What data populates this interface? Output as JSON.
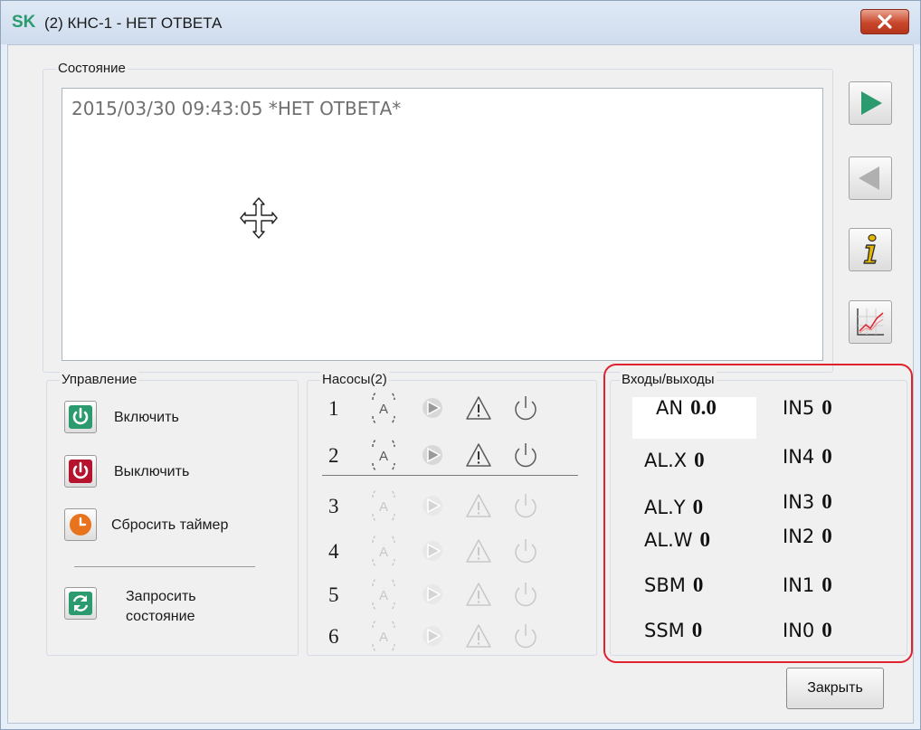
{
  "window": {
    "app_mark": "SK",
    "title": "(2) КНС-1 - НЕТ ОТВЕТА"
  },
  "status": {
    "legend": "Состояние",
    "line": "2015/03/30 09:43:05 *НЕТ ОТВЕТА*"
  },
  "side_buttons": [
    {
      "icon": "play-forward-icon"
    },
    {
      "icon": "play-back-icon"
    },
    {
      "icon": "info-icon"
    },
    {
      "icon": "chart-icon"
    }
  ],
  "control": {
    "legend": "Управление",
    "buttons": [
      {
        "label": "Включить",
        "icon": "power-on-icon"
      },
      {
        "label": "Выключить",
        "icon": "power-off-icon"
      },
      {
        "label": "Сбросить таймер",
        "icon": "timer-icon"
      },
      {
        "label_line1": "Запросить",
        "label_line2": "состояние",
        "icon": "refresh-icon"
      }
    ]
  },
  "pumps": {
    "legend": "Насосы(2)",
    "rows": [
      {
        "num": "1",
        "active": true
      },
      {
        "num": "2",
        "active": true
      },
      {
        "num": "3",
        "active": false
      },
      {
        "num": "4",
        "active": false
      },
      {
        "num": "5",
        "active": false
      },
      {
        "num": "6",
        "active": false
      }
    ]
  },
  "io": {
    "legend": "Входы/выходы",
    "highlight_color": "#e0222e",
    "left": [
      {
        "label": "AN",
        "value": "0.0"
      },
      {
        "label": "AL.X",
        "value": "0"
      },
      {
        "label": "AL.Y",
        "value": "0"
      },
      {
        "label": "AL.W",
        "value": "0"
      },
      {
        "label": "SBM",
        "value": "0"
      },
      {
        "label": "SSM",
        "value": "0"
      }
    ],
    "right": [
      {
        "label": "IN5",
        "value": "0"
      },
      {
        "label": "IN4",
        "value": "0"
      },
      {
        "label": "IN3",
        "value": "0"
      },
      {
        "label": "IN2",
        "value": "0"
      },
      {
        "label": "IN1",
        "value": "0"
      },
      {
        "label": "IN0",
        "value": "0"
      }
    ]
  },
  "footer": {
    "close_label": "Закрыть"
  },
  "colors": {
    "accent_green": "#2b9a6e",
    "power_off_red": "#b5132e",
    "timer_orange": "#e8731c",
    "disabled_icon": "#c8c8c8"
  }
}
